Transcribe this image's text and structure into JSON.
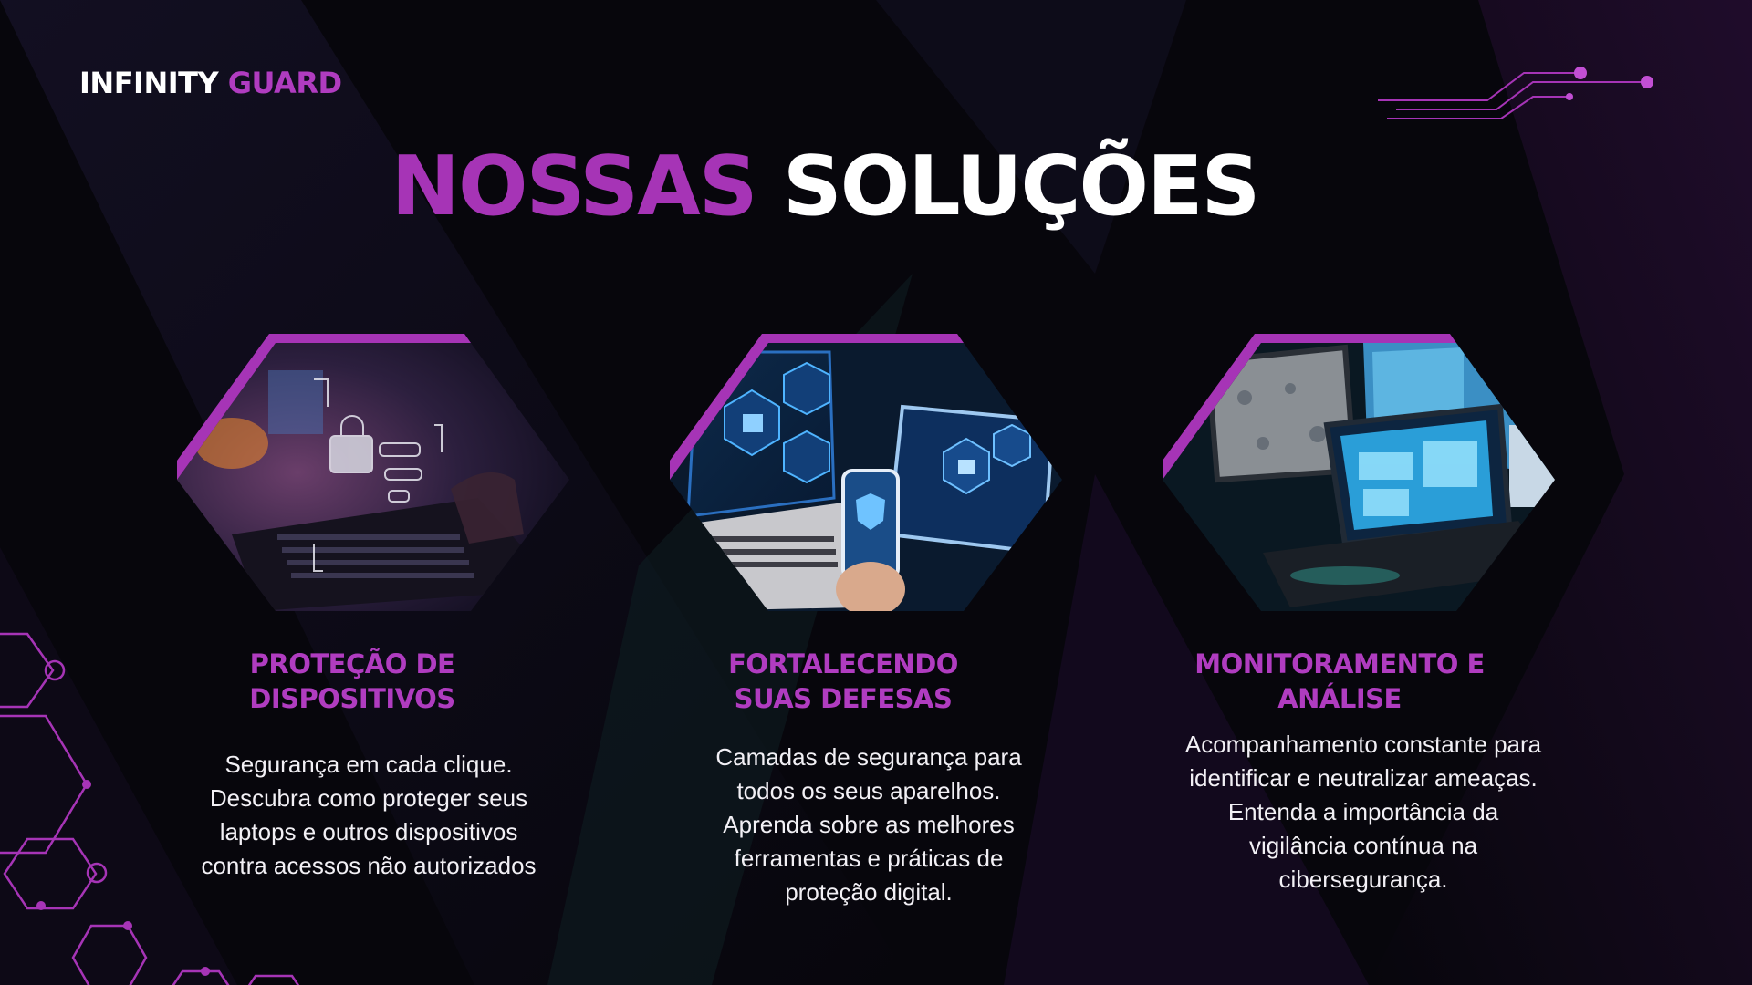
{
  "brand": {
    "name_part1": "INFINITY",
    "name_part2": "GUARD"
  },
  "heading": {
    "part1": "NOSSAS",
    "part2": "SOLUÇÕES"
  },
  "cards": [
    {
      "title_lines": [
        "PROTEÇÃO DE",
        "DISPOSITIVOS"
      ],
      "body_lines": [
        "Segurança em cada clique.",
        "Descubra como proteger seus",
        "laptops e outros dispositivos",
        "contra acessos não autorizados"
      ],
      "image_icon": "laptop-lock-icon"
    },
    {
      "title_lines": [
        "FORTALECENDO",
        "SUAS DEFESAS"
      ],
      "body_lines": [
        "Camadas de segurança para",
        "todos os seus aparelhos.",
        "Aprenda sobre as melhores",
        "ferramentas e práticas de",
        "proteção digital."
      ],
      "image_icon": "devices-shield-icon"
    },
    {
      "title_lines": [
        "MONITORAMENTO E",
        "ANÁLISE"
      ],
      "body_lines": [
        "Acompanhamento constante para",
        "identificar e neutralizar ameaças.",
        "Entenda a importância da",
        "vigilância contínua na",
        "cibersegurança."
      ],
      "image_icon": "monitoring-screens-icon"
    }
  ],
  "colors": {
    "accent": "#a634b6",
    "accent_light": "#b03cc0",
    "background": "#07060c",
    "text": "#ffffff"
  }
}
